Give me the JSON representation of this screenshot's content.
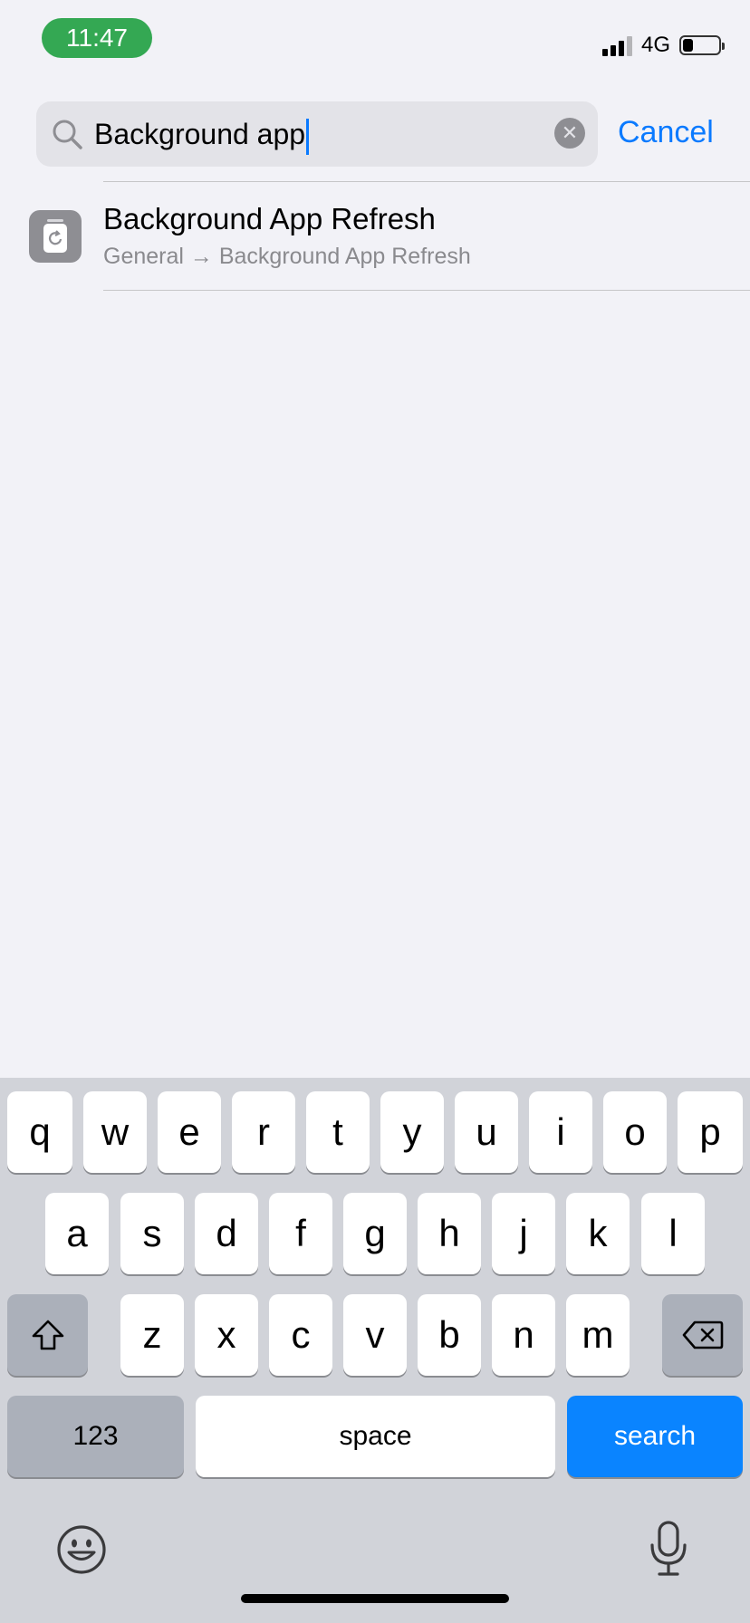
{
  "status_bar": {
    "time": "11:47",
    "network": "4G",
    "battery_level": 0.3,
    "signal_bars": 3
  },
  "search": {
    "query": "Background app",
    "cancel_label": "Cancel"
  },
  "results": [
    {
      "title": "Background App Refresh",
      "path": "General → Background App Refresh"
    }
  ],
  "keyboard": {
    "row1": [
      "q",
      "w",
      "e",
      "r",
      "t",
      "y",
      "u",
      "i",
      "o",
      "p"
    ],
    "row2": [
      "a",
      "s",
      "d",
      "f",
      "g",
      "h",
      "j",
      "k",
      "l"
    ],
    "row3": [
      "z",
      "x",
      "c",
      "v",
      "b",
      "n",
      "m"
    ],
    "numbers_label": "123",
    "space_label": "space",
    "search_label": "search"
  },
  "colors": {
    "accent": "#0a7aff",
    "time_pill": "#34a853",
    "search_key": "#0a84ff"
  }
}
